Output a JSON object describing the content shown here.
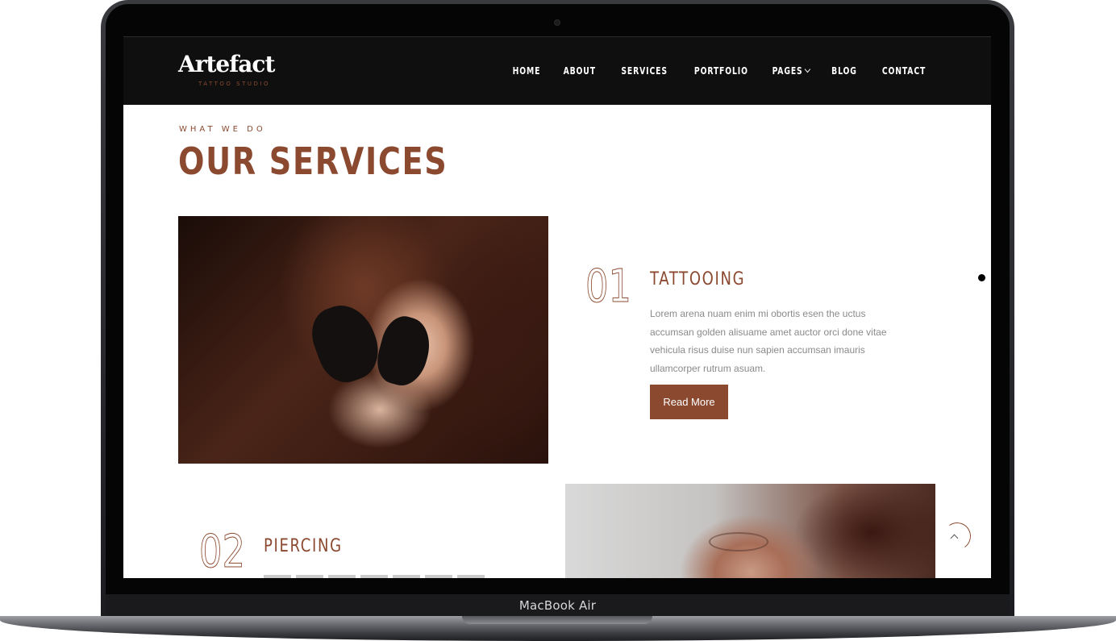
{
  "device": {
    "label": "MacBook Air"
  },
  "brand": {
    "name": "Artefact",
    "tagline": "TATTOO STUDIO",
    "accent": "#8b4a30"
  },
  "nav": {
    "items": [
      "HOME",
      "ABOUT",
      "SERVICES",
      "PORTFOLIO",
      "PAGES",
      "BLOG",
      "CONTACT"
    ]
  },
  "section": {
    "eyebrow": "WHAT WE DO",
    "title": "OUR SERVICES"
  },
  "services": [
    {
      "number": "01",
      "title": "TATTOOING",
      "text": "Lorem arena nuam enim mi obortis esen the uctus accumsan golden alisuame amet auctor orci done vitae vehicula risus duise nun sapien accumsan imauris ullamcorper rutrum asuam.",
      "button": "Read More"
    },
    {
      "number": "02",
      "title": "PIERCING"
    }
  ]
}
